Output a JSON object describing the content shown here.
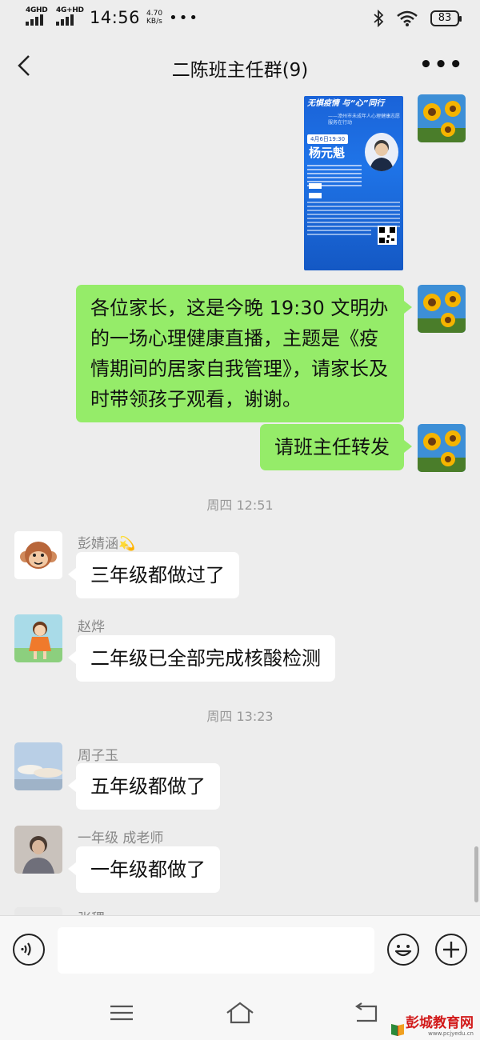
{
  "status_bar": {
    "net1": "4GHD",
    "net2": "4G+HD",
    "time": "14:56",
    "speed_value": "4.70",
    "speed_unit": "KB/s",
    "dots": "•••",
    "battery": "83"
  },
  "header": {
    "title": "二陈班主任群(9)",
    "more": "•••"
  },
  "poster": {
    "title": "无惧疫情 与“心”同行",
    "subtitle": "——漳州市未成年人心理健康志愿服务在行动",
    "date": "4月6日19:30",
    "speaker": "杨元魁"
  },
  "messages": {
    "m1": "各位家长，这是今晚 19:30 文明办的一场心理健康直播，主题是《疫情期间的居家自我管理》，请家长及时带领孩子观看，谢谢。",
    "m2": "请班主任转发",
    "ts1": "周四 12:51",
    "s3": "彭婧涵💫",
    "m3": "三年级都做过了",
    "s4": "赵烨",
    "m4": "二年级已全部完成核酸检测",
    "ts2": "周四 13:23",
    "s5": "周子玉",
    "m5": "五年级都做了",
    "s6": "一年级 成老师",
    "m6": "一年级都做了",
    "s7": "张稷"
  },
  "input": {
    "placeholder": ""
  },
  "watermark": {
    "main": "彭城教育网",
    "sub": "www.pcjyedu.cn"
  },
  "colors": {
    "background": "#ededed",
    "bubble_self": "#95ec69",
    "bubble_other": "#ffffff",
    "poster_blue": "#1a63d8"
  }
}
